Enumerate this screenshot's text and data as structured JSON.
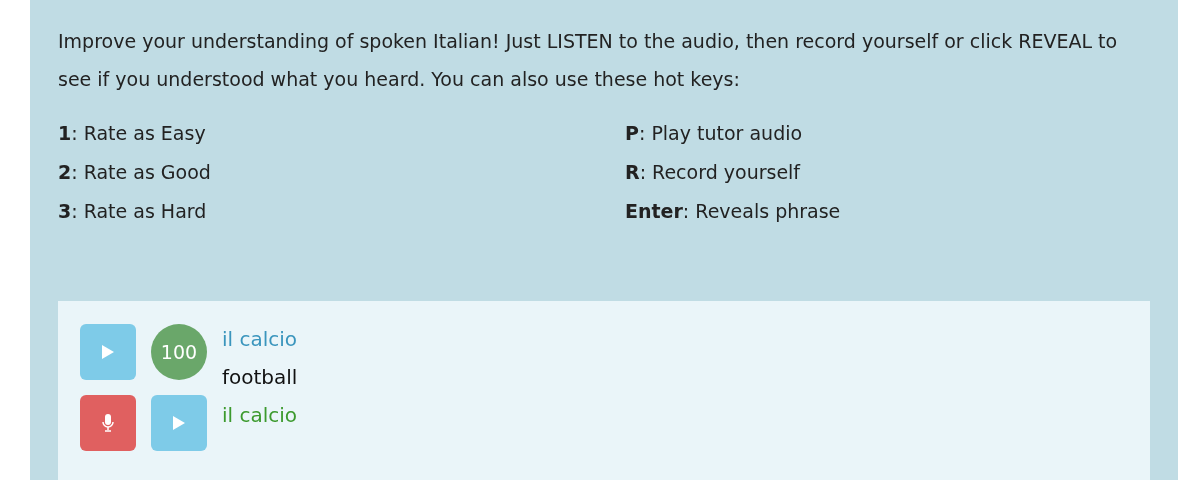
{
  "instructions": "Improve your understanding of spoken Italian! Just LISTEN to the audio, then record yourself or click REVEAL to see if you understood what you heard. You can also use these hot keys:",
  "hotkeys": [
    [
      "**1**: Rate as Easy",
      "**2**: Rate as Good",
      "**3**: Rate as Hard"
    ],
    [
      "**P**: Play tutor audio",
      "**R**: Record yourself",
      "**Enter**: Reveals phrase"
    ]
  ],
  "card": {
    "controls": [
      {
        "kind": "play"
      },
      {
        "kind": "score",
        "text": "100"
      },
      {
        "kind": "record"
      },
      {
        "kind": "play"
      }
    ],
    "phrase": "il calcio",
    "translation": "football",
    "transcript": "il calcio"
  }
}
